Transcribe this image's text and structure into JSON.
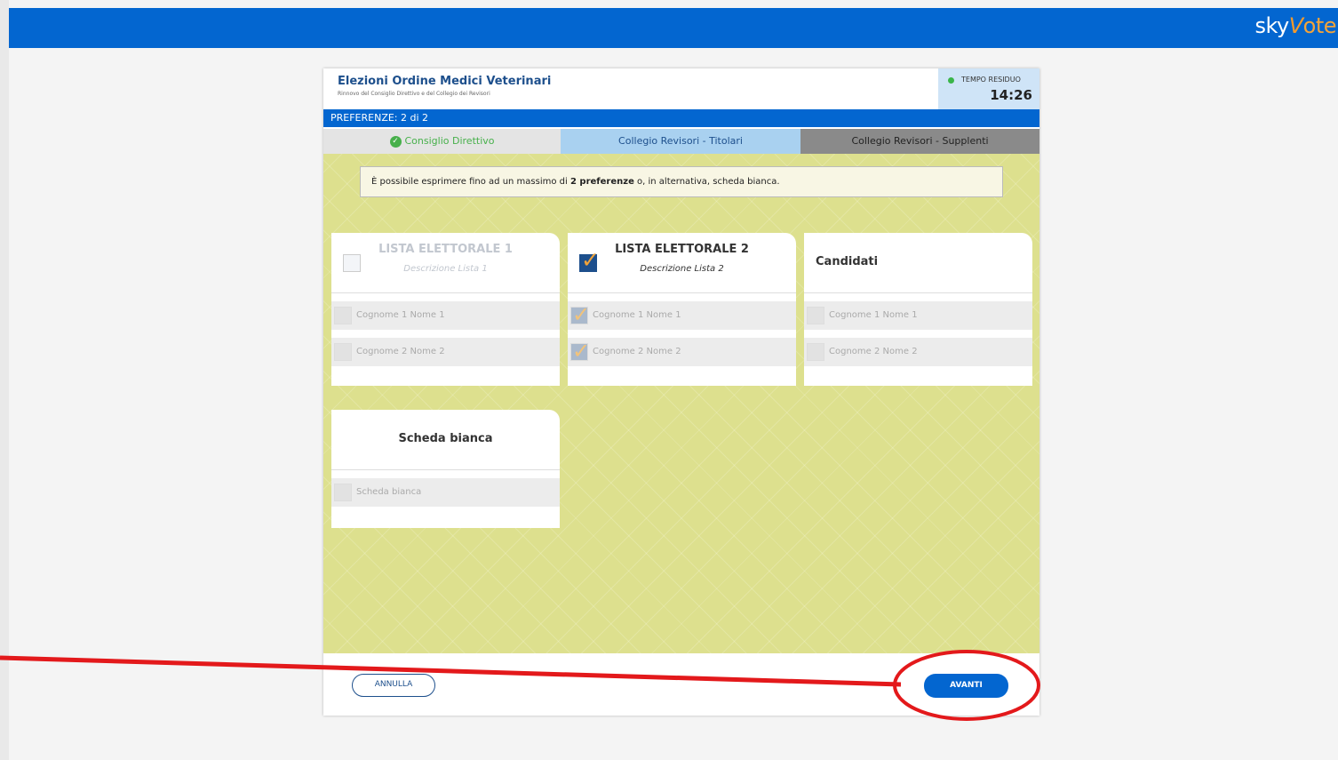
{
  "brand": {
    "sky": "sky",
    "v": "V",
    "ote": "ote"
  },
  "header": {
    "title": "Elezioni Ordine Medici Veterinari",
    "subtitle": "Rinnovo del Consiglio Direttivo e del Collegio dei Revisori",
    "timer_label": "TEMPO RESIDUO",
    "timer_value": "14:26"
  },
  "preferences_label": "PREFERENZE: 2 di 2",
  "tabs": [
    {
      "label": "Consiglio Direttivo",
      "state": "completed"
    },
    {
      "label": "Collegio Revisori - Titolari",
      "state": "active"
    },
    {
      "label": "Collegio Revisori - Supplenti",
      "state": "pending"
    }
  ],
  "notice": {
    "prefix": "È possibile esprimere fino ad un massimo di ",
    "bold": "2 preferenze",
    "suffix": " o, in alternativa, scheda bianca."
  },
  "cards": [
    {
      "title": "LISTA ELETTORALE 1",
      "description": "Descrizione Lista 1",
      "checked": false,
      "rows": [
        {
          "label": "Cognome 1 Nome 1",
          "checked": false
        },
        {
          "label": "Cognome 2 Nome 2",
          "checked": false
        }
      ]
    },
    {
      "title": "LISTA ELETTORALE 2",
      "description": "Descrizione Lista 2",
      "checked": true,
      "rows": [
        {
          "label": "Cognome 1 Nome 1",
          "checked": true
        },
        {
          "label": "Cognome 2 Nome 2",
          "checked": true
        }
      ]
    },
    {
      "title": "Candidati",
      "rows": [
        {
          "label": "Cognome 1 Nome 1",
          "checked": false
        },
        {
          "label": "Cognome 2 Nome 2",
          "checked": false
        }
      ]
    },
    {
      "title": "Scheda bianca",
      "rows": [
        {
          "label": "Scheda bianca",
          "checked": false
        }
      ]
    }
  ],
  "footer": {
    "cancel_label": "ANNULLA",
    "next_label": "AVANTI"
  },
  "colors": {
    "primary": "#0366d0",
    "success": "#47b04b",
    "ballot_bg": "#dde08e",
    "annotation": "#e3191b"
  },
  "icons": {
    "completed_tab": "check-circle-icon",
    "checked_box": "checkmark-icon"
  }
}
